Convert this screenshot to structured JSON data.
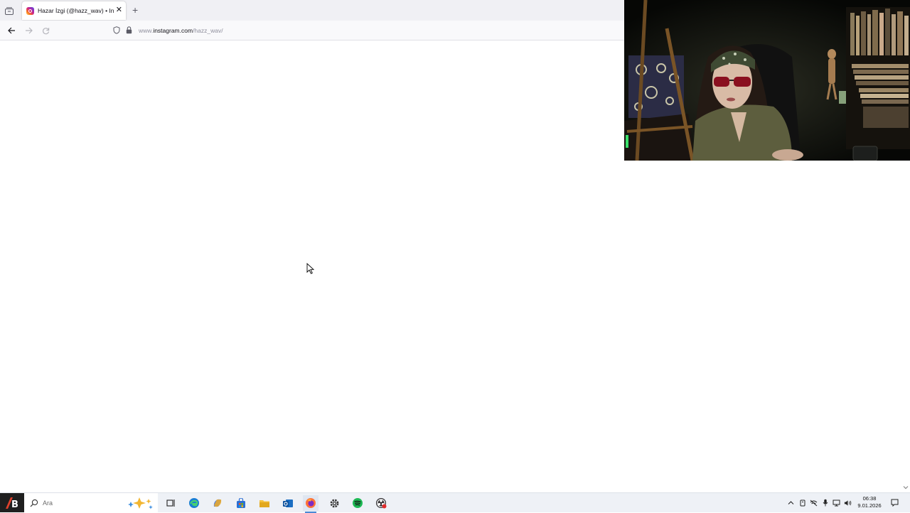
{
  "browser": {
    "tab": {
      "title": "Hazar İzgi (@hazz_wav) • Instag",
      "close_glyph": "✕",
      "favicon": "instagram-icon"
    },
    "new_tab_glyph": "+",
    "nav": {
      "back": "back-arrow-icon",
      "forward": "forward-arrow-icon",
      "reload": "reload-icon"
    },
    "url": {
      "prefix": "www.",
      "host": "instagram.com",
      "path": "/hazz_wav/"
    }
  },
  "taskbar": {
    "search_text": "Ara",
    "apps": [
      "task-view-icon",
      "edge-icon",
      "copilot-icon",
      "store-icon",
      "file-explorer-icon",
      "outlook-icon",
      "firefox-icon",
      "settings-icon",
      "spotify-icon",
      "obs-icon"
    ],
    "active_app": "firefox-icon",
    "clock": {
      "time": "06:38",
      "date": "9.01.2026"
    }
  },
  "colors": {
    "tabbar_bg": "#f0f0f4",
    "navbar_bg": "#f9f9fb",
    "taskbar_bg": "#eef1f6",
    "spotify_green": "#1db954",
    "firefox_orange": "#ff7139"
  }
}
